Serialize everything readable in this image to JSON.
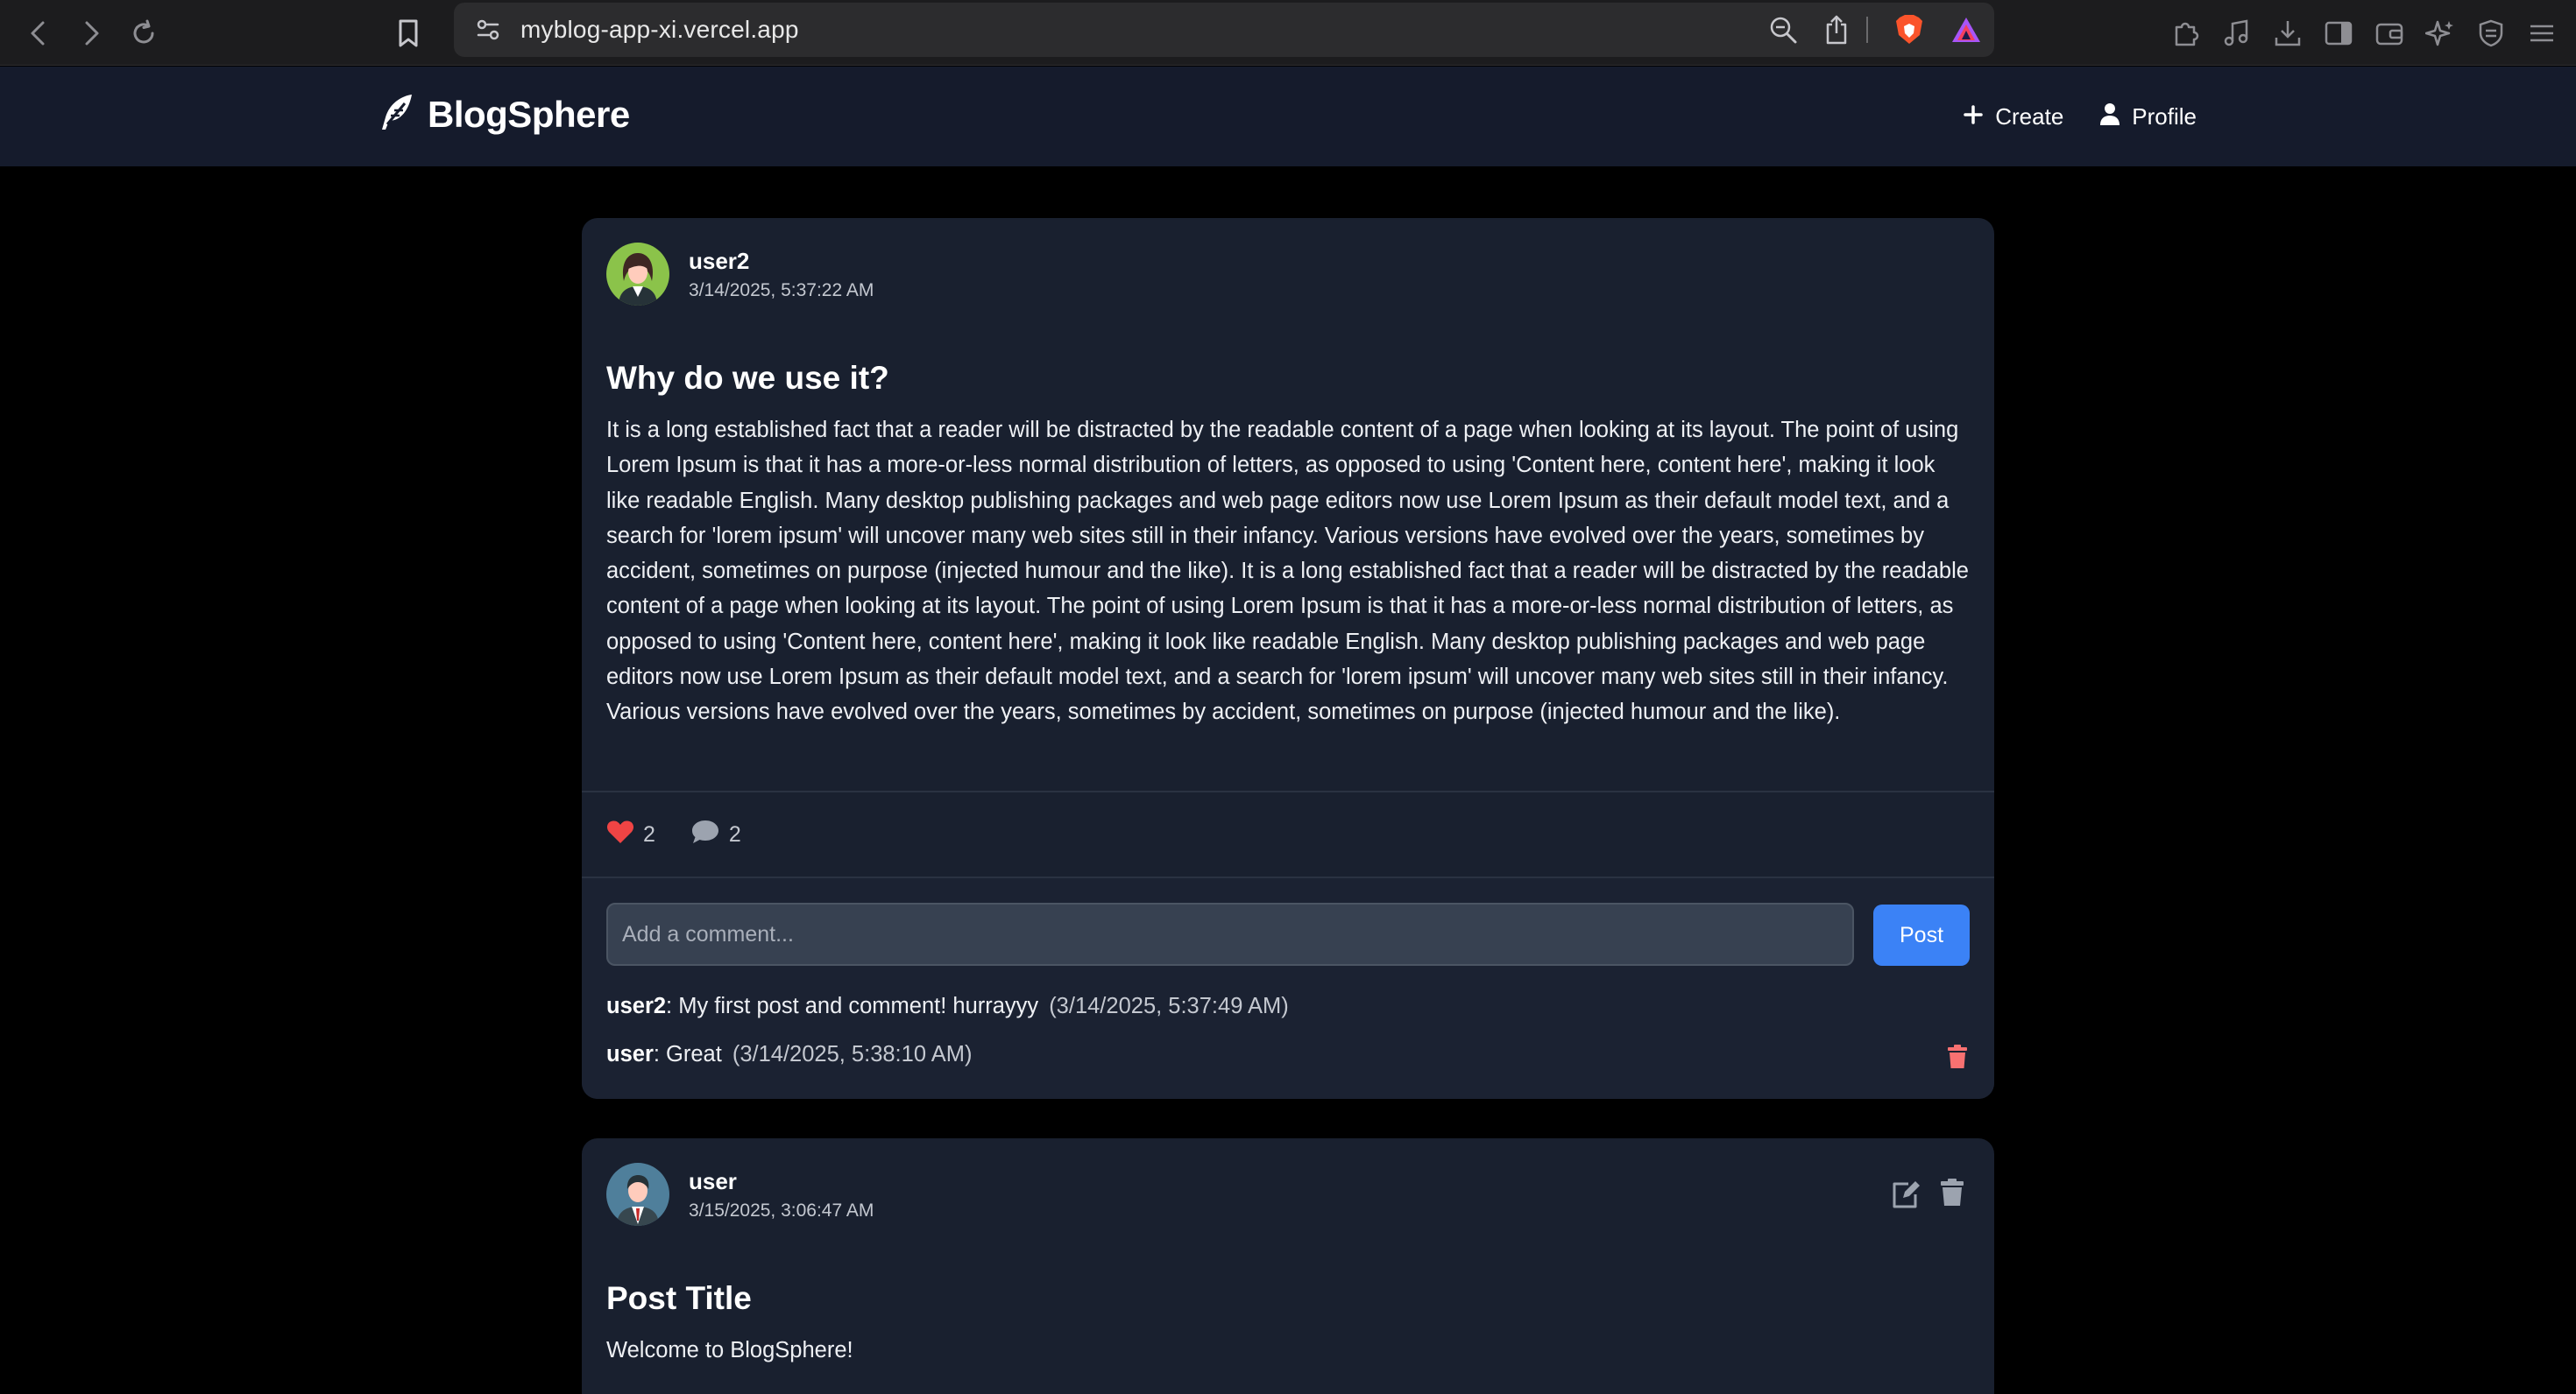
{
  "browser": {
    "url": "myblog-app-xi.vercel.app"
  },
  "app": {
    "brand": "BlogSphere",
    "nav": {
      "create_label": "Create",
      "profile_label": "Profile"
    }
  },
  "posts": [
    {
      "username": "user2",
      "date": "3/14/2025, 5:37:22 AM",
      "title": "Why do we use it?",
      "body": "It is a long established fact that a reader will be distracted by the readable content of a page when looking at its layout. The point of using Lorem Ipsum is that it has a more-or-less normal distribution of letters, as opposed to using 'Content here, content here', making it look like readable English. Many desktop publishing packages and web page editors now use Lorem Ipsum as their default model text, and a search for 'lorem ipsum' will uncover many web sites still in their infancy. Various versions have evolved over the years, sometimes by accident, sometimes on purpose (injected humour and the like). It is a long established fact that a reader will be distracted by the readable content of a page when looking at its layout. The point of using Lorem Ipsum is that it has a more-or-less normal distribution of letters, as opposed to using 'Content here, content here', making it look like readable English. Many desktop publishing packages and web page editors now use Lorem Ipsum as their default model text, and a search for 'lorem ipsum' will uncover many web sites still in their infancy. Various versions have evolved over the years, sometimes by accident, sometimes on purpose (injected humour and the like).",
      "likes": "2",
      "comments_count": "2",
      "comment_placeholder": "Add a comment...",
      "post_button": "Post",
      "comments": [
        {
          "user": "user2",
          "text": ": My first post and comment! hurrayyy",
          "time": "(3/14/2025, 5:37:49 AM)"
        },
        {
          "user": "user",
          "text": ": Great",
          "time": "(3/14/2025, 5:38:10 AM)"
        }
      ]
    },
    {
      "username": "user",
      "date": "3/15/2025, 3:06:47 AM",
      "title": "Post Title",
      "body": "Welcome to BlogSphere!"
    }
  ],
  "colors": {
    "accent": "#3b82f6",
    "like": "#ef4444",
    "delete": "#f87171",
    "card": "#19202f",
    "header": "#151b2c"
  }
}
